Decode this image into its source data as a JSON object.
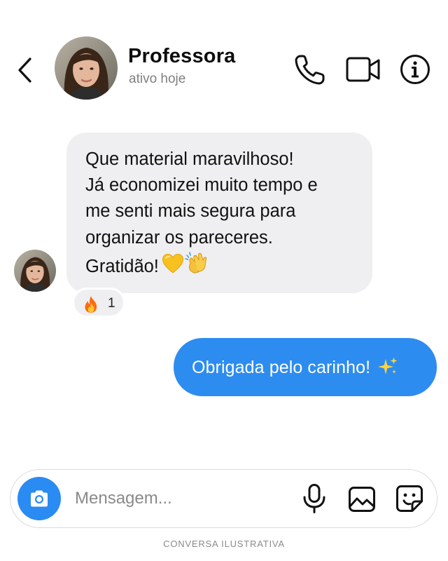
{
  "header": {
    "contact_name": "Professora",
    "status": "ativo hoje",
    "icons": {
      "back": "chevron-left-icon",
      "call": "phone-icon",
      "video": "video-camera-icon",
      "info": "info-icon"
    }
  },
  "messages": [
    {
      "direction": "incoming",
      "text": "Que material maravilhoso!\nJá economizei muito tempo e\nme senti mais segura para\norganizar os pareceres.\nGratidão!",
      "emojis": [
        "yellow-heart-emoji",
        "clapping-hands-emoji"
      ],
      "reaction": {
        "emoji": "fire-emoji",
        "count": "1"
      }
    },
    {
      "direction": "outgoing",
      "text": "Obrigada pelo carinho!",
      "emojis": [
        "sparkles-emoji"
      ]
    }
  ],
  "composer": {
    "placeholder": "Mensagem...",
    "icons": [
      "camera-icon",
      "microphone-icon",
      "image-icon",
      "sticker-icon"
    ]
  },
  "footer_caption": "CONVERSA ILUSTRATIVA",
  "colors": {
    "outgoing_bubble": "#2d8cf0",
    "incoming_bubble": "#efeff1",
    "camera_button": "#2a8bf2",
    "status_text": "#808080"
  }
}
